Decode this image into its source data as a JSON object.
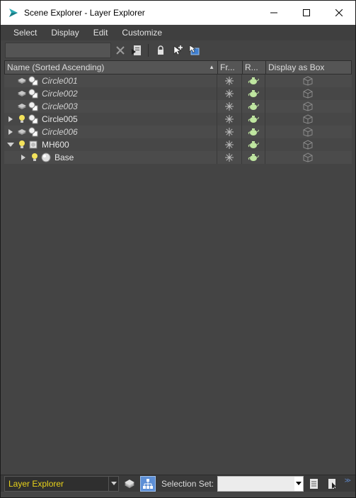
{
  "window": {
    "title": "Scene Explorer - Layer Explorer"
  },
  "menu": [
    "Select",
    "Display",
    "Edit",
    "Customize"
  ],
  "toolbar": {
    "search_value": ""
  },
  "columns": {
    "name": "Name (Sorted Ascending)",
    "freeze": "Fr...",
    "render": "R...",
    "display_box": "Display as Box"
  },
  "rows": [
    {
      "label": "Circle001",
      "italic": true
    },
    {
      "label": "Circle002",
      "italic": true
    },
    {
      "label": "Circle003",
      "italic": true
    },
    {
      "label": "Circle005",
      "italic": false
    },
    {
      "label": "Circle006",
      "italic": true
    },
    {
      "label": "MH600",
      "italic": false
    },
    {
      "label": "Base",
      "italic": false
    }
  ],
  "statusbar": {
    "explorer": "Layer Explorer",
    "selection_set_label": "Selection Set:",
    "selection_set_value": ""
  },
  "colors": {
    "background": "#444444",
    "accent": "#5d8fd6",
    "explorer_text": "#e8d21a"
  }
}
